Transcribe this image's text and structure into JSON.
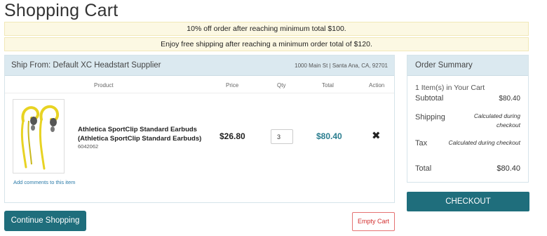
{
  "page": {
    "title": "Shopping Cart"
  },
  "promos": [
    "10% off order after reaching minimum total $100.",
    "Enjoy free shipping after reaching a minimum order total of $120."
  ],
  "cart": {
    "ship_from": "Ship From: Default XC Headstart Supplier",
    "ship_address": "1000 Main St | Santa Ana, CA, 92701",
    "columns": [
      "Product",
      "Price",
      "Qty",
      "Total",
      "Action"
    ],
    "items": [
      {
        "name": "Athletica SportClip Standard Earbuds (Athletica SportClip Standard Earbuds)",
        "sku": "6042062",
        "price": "$26.80",
        "qty": "3",
        "total": "$80.40",
        "remove_icon": "✖",
        "add_comments": "Add comments to this item",
        "image_icon": "earbuds-product-image"
      }
    ]
  },
  "summary": {
    "title": "Order Summary",
    "items_count": "1 Item(s) in Your Cart",
    "subtotal_label": "Subtotal",
    "subtotal_value": "$80.40",
    "shipping_label": "Shipping",
    "shipping_value": "Calculated during checkout",
    "tax_label": "Tax",
    "tax_value": "Calculated during checkout",
    "total_label": "Total",
    "total_value": "$80.40"
  },
  "buttons": {
    "checkout": "CHECKOUT",
    "continue_shopping": "Continue Shopping",
    "empty_cart": "Empty Cart"
  },
  "colors": {
    "primary": "#1f6e7c",
    "panel_header": "#dbe9f0",
    "promo_bg": "#fcf8e3",
    "total_text": "#2a7d8f",
    "danger": "#d32f2f"
  }
}
